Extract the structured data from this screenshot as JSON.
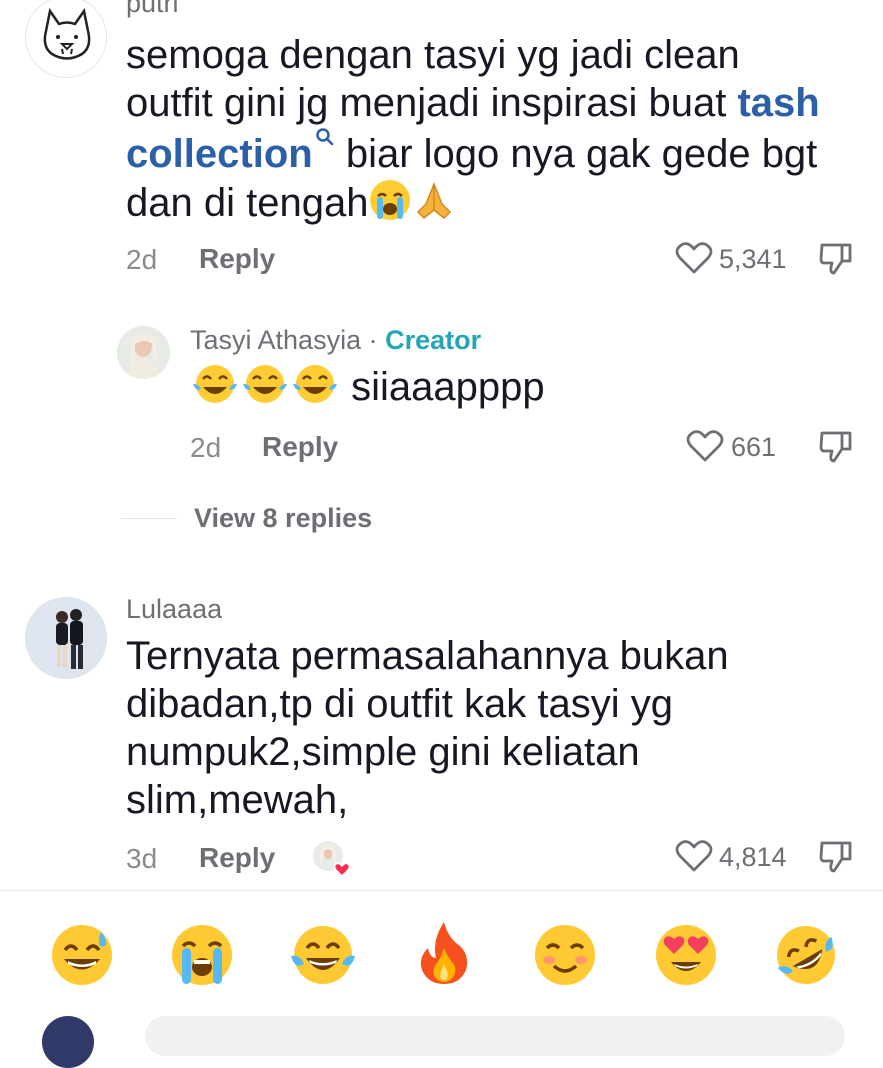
{
  "comments": [
    {
      "username": "putri",
      "text_part1": "semoga dengan tasyi yg jadi clean outfit gini jg menjadi inspirasi buat",
      "link": "tash collection",
      "text_part2": "biar logo nya gak gede bgt dan di tengah",
      "age": "2d",
      "reply_label": "Reply",
      "likes": "5,341",
      "avatar_icon": "cat-face-icon"
    },
    {
      "username": "Tasyi Athasyia",
      "separator": "·",
      "badge": "Creator",
      "text": "siiaaapppp",
      "age": "2d",
      "reply_label": "Reply",
      "likes": "661"
    },
    {
      "username": "Lulaaaa",
      "text": "Ternyata permasalahannya bukan dibadan,tp di outfit kak tasyi yg numpuk2,simple gini keliatan slim,mewah,",
      "age": "3d",
      "reply_label": "Reply",
      "likes": "4,814"
    }
  ],
  "view_replies": "View 8 replies",
  "quick_emojis": [
    "sweat-smile",
    "loudly-crying",
    "tears-of-joy",
    "fire",
    "smiling-blush",
    "heart-eyes",
    "rofl"
  ],
  "colors": {
    "link": "#2b5fa8",
    "creator": "#22a6b8",
    "text": "#161823",
    "muted": "#8a8b91"
  }
}
